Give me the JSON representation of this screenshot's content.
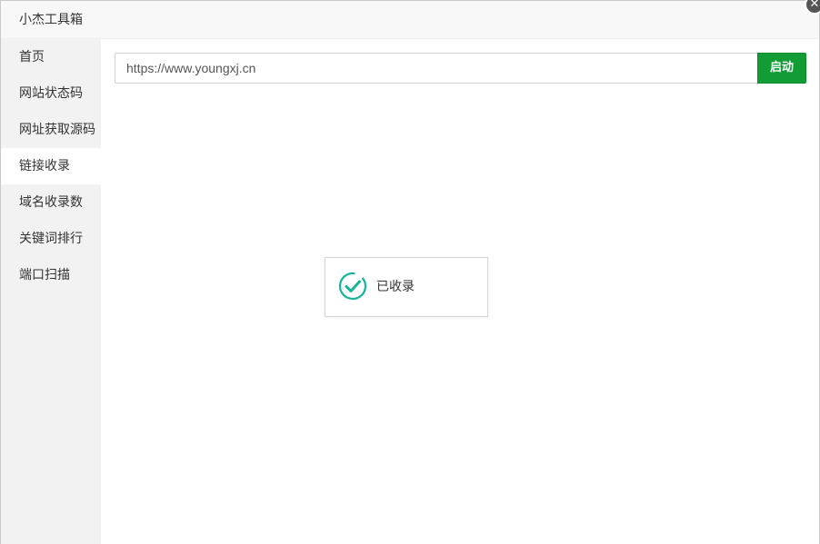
{
  "window": {
    "title": "小杰工具箱",
    "close_glyph": "✕"
  },
  "sidebar": {
    "items": [
      {
        "label": "首页",
        "active": false
      },
      {
        "label": "网站状态码",
        "active": false
      },
      {
        "label": "网址获取源码",
        "active": false
      },
      {
        "label": "链接收录",
        "active": true
      },
      {
        "label": "域名收录数",
        "active": false
      },
      {
        "label": "关键词排行",
        "active": false
      },
      {
        "label": "端口扫描",
        "active": false
      }
    ]
  },
  "main": {
    "url_input": {
      "value": "https://www.youngxj.cn"
    },
    "start_button": {
      "label": "启动"
    },
    "toast": {
      "message": "已收录",
      "icon": "check-circle-icon",
      "icon_color": "#16b59a"
    }
  },
  "colors": {
    "accent": "#129c35",
    "sidebar_bg": "#f2f2f2",
    "success": "#16b59a"
  }
}
